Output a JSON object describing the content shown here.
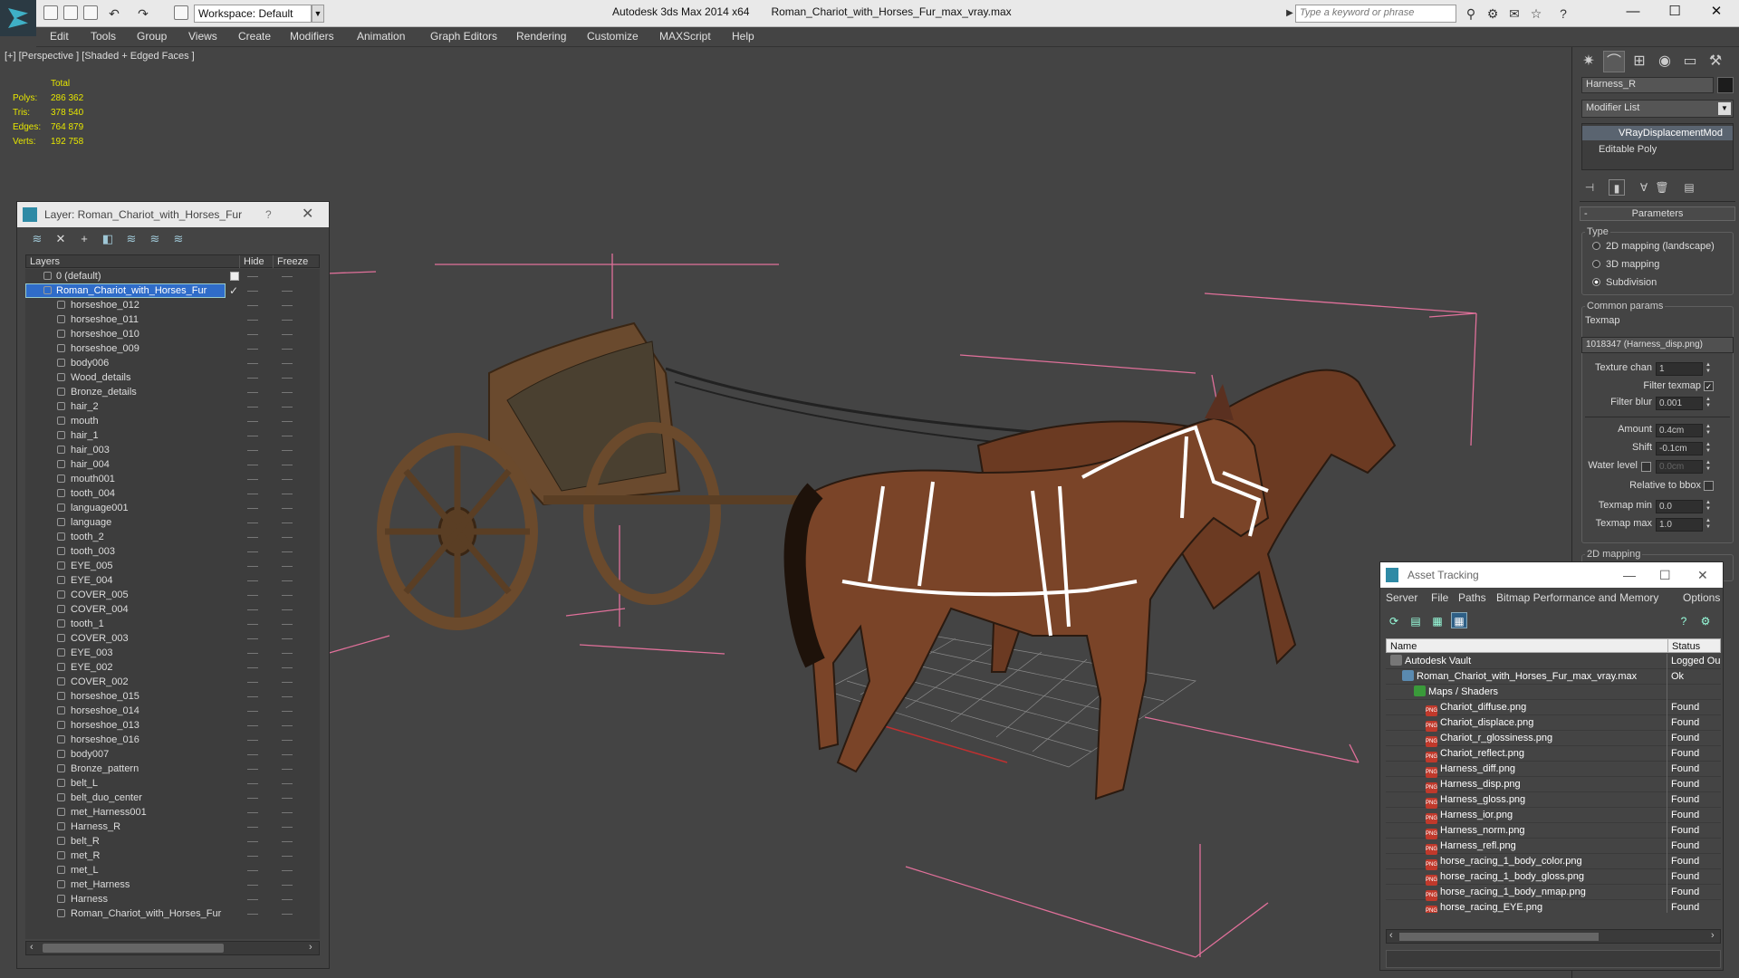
{
  "app": {
    "title": "Autodesk 3ds Max  2014 x64",
    "file": "Roman_Chariot_with_Horses_Fur_max_vray.max",
    "workspace": "Workspace: Default",
    "search_placeholder": "Type a keyword or phrase"
  },
  "menu": [
    "Edit",
    "Tools",
    "Group",
    "Views",
    "Create",
    "Modifiers",
    "Animation",
    "Graph Editors",
    "Rendering",
    "Customize",
    "MAXScript",
    "Help"
  ],
  "viewport": {
    "label": "[+] [Perspective ] [Shaded + Edged Faces ]",
    "stats_header": "Total",
    "stats": [
      {
        "label": "Polys:",
        "value": "286 362"
      },
      {
        "label": "Tris:",
        "value": "378 540"
      },
      {
        "label": "Edges:",
        "value": "764 879"
      },
      {
        "label": "Verts:",
        "value": "192 758"
      }
    ]
  },
  "command_panel": {
    "object_name": "Harness_R",
    "modifier_list": "Modifier List",
    "stack": [
      "VRayDisplacementMod",
      "Editable Poly"
    ],
    "rollout": "Parameters",
    "type_label": "Type",
    "type_options": [
      {
        "label": "2D mapping (landscape)",
        "selected": false
      },
      {
        "label": "3D mapping",
        "selected": false
      },
      {
        "label": "Subdivision",
        "selected": true
      }
    ],
    "common_label": "Common params",
    "texmap_label": "Texmap",
    "texmap_value": "1018347 (Harness_disp.png)",
    "texture_chan_label": "Texture chan",
    "texture_chan": "1",
    "filter_texmap_label": "Filter texmap",
    "filter_blur_label": "Filter blur",
    "filter_blur": "0.001",
    "amount_label": "Amount",
    "amount": "0.4cm",
    "shift_label": "Shift",
    "shift": "-0.1cm",
    "water_label": "Water level",
    "water": "0.0cm",
    "relative_label": "Relative to bbox",
    "texmap_min_label": "Texmap min",
    "texmap_min": "0.0",
    "texmap_max_label": "Texmap max",
    "texmap_max": "1.0",
    "next_group": "2D mapping"
  },
  "layer_window": {
    "title": "Layer: Roman_Chariot_with_Horses_Fur",
    "help": "?",
    "col_layers": "Layers",
    "col_hide": "Hide",
    "col_freeze": "Freeze",
    "default_layer": "0 (default)",
    "active_layer": "Roman_Chariot_with_Horses_Fur",
    "items": [
      "horseshoe_012",
      "horseshoe_011",
      "horseshoe_010",
      "horseshoe_009",
      "body006",
      "Wood_details",
      "Bronze_details",
      "hair_2",
      "mouth",
      "hair_1",
      "hair_003",
      "hair_004",
      "mouth001",
      "tooth_004",
      "language001",
      "language",
      "tooth_2",
      "tooth_003",
      "EYE_005",
      "EYE_004",
      "COVER_005",
      "COVER_004",
      "tooth_1",
      "COVER_003",
      "EYE_003",
      "EYE_002",
      "COVER_002",
      "horseshoe_015",
      "horseshoe_014",
      "horseshoe_013",
      "horseshoe_016",
      "body007",
      "Bronze_pattern",
      "belt_L",
      "belt_duo_center",
      "met_Harness001",
      "Harness_R",
      "belt_R",
      "met_R",
      "met_L",
      "met_Harness",
      "Harness",
      "Roman_Chariot_with_Horses_Fur"
    ]
  },
  "asset_tracking": {
    "title": "Asset Tracking",
    "menu": [
      "Server",
      "File",
      "Paths",
      "Bitmap Performance and Memory",
      "Options"
    ],
    "col_name": "Name",
    "col_status": "Status",
    "rows": [
      {
        "name": "Autodesk Vault",
        "status": "Logged Ou",
        "indent": 1,
        "kind": "vault"
      },
      {
        "name": "Roman_Chariot_with_Horses_Fur_max_vray.max",
        "status": "Ok",
        "indent": 2,
        "kind": "max"
      },
      {
        "name": "Maps / Shaders",
        "status": "",
        "indent": 3,
        "kind": "folder"
      },
      {
        "name": "Chariot_diffuse.png",
        "status": "Found",
        "indent": 4,
        "kind": "png"
      },
      {
        "name": "Chariot_displace.png",
        "status": "Found",
        "indent": 4,
        "kind": "png"
      },
      {
        "name": "Chariot_r_glossiness.png",
        "status": "Found",
        "indent": 4,
        "kind": "png"
      },
      {
        "name": "Chariot_reflect.png",
        "status": "Found",
        "indent": 4,
        "kind": "png"
      },
      {
        "name": "Harness_diff.png",
        "status": "Found",
        "indent": 4,
        "kind": "png"
      },
      {
        "name": "Harness_disp.png",
        "status": "Found",
        "indent": 4,
        "kind": "png"
      },
      {
        "name": "Harness_gloss.png",
        "status": "Found",
        "indent": 4,
        "kind": "png"
      },
      {
        "name": "Harness_ior.png",
        "status": "Found",
        "indent": 4,
        "kind": "png"
      },
      {
        "name": "Harness_norm.png",
        "status": "Found",
        "indent": 4,
        "kind": "png"
      },
      {
        "name": "Harness_refl.png",
        "status": "Found",
        "indent": 4,
        "kind": "png"
      },
      {
        "name": "horse_racing_1_body_color.png",
        "status": "Found",
        "indent": 4,
        "kind": "png"
      },
      {
        "name": "horse_racing_1_body_gloss.png",
        "status": "Found",
        "indent": 4,
        "kind": "png"
      },
      {
        "name": "horse_racing_1_body_nmap.png",
        "status": "Found",
        "indent": 4,
        "kind": "png"
      },
      {
        "name": "horse_racing_EYE.png",
        "status": "Found",
        "indent": 4,
        "kind": "png"
      }
    ]
  },
  "colors": {
    "accent": "#2f6cc9",
    "stats": "#e6e600",
    "bbox": "#e0709a"
  }
}
